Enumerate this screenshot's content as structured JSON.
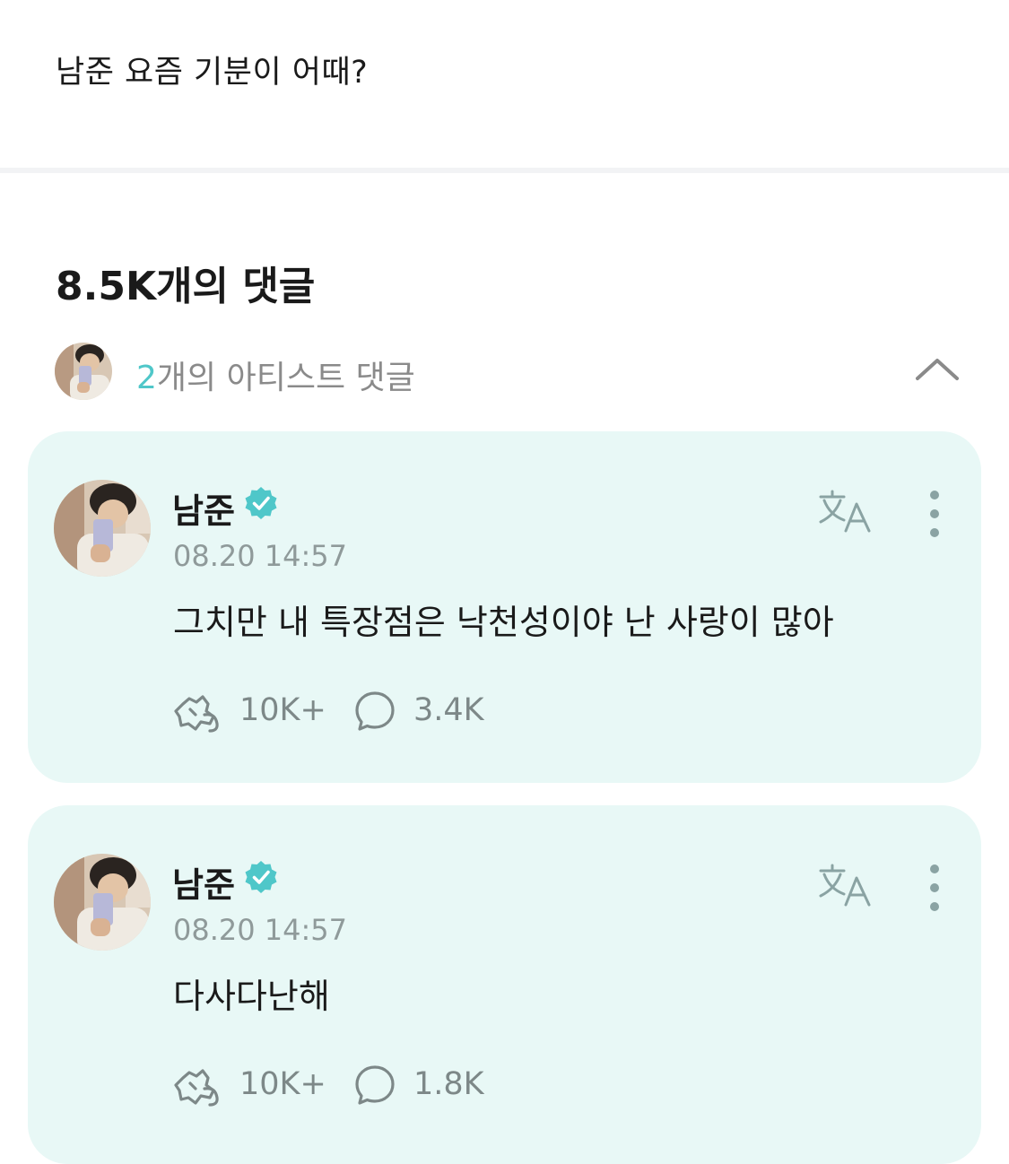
{
  "post": {
    "text": "남준 요즘 기분이 어때?"
  },
  "comments_header": {
    "count_label": "8.5K개의 댓글"
  },
  "artist_section": {
    "count_number": "2",
    "count_suffix": "개의 아티스트 댓글",
    "collapse_icon": "chevron-up-icon"
  },
  "comments": [
    {
      "author": "남준",
      "verified": true,
      "timestamp": "08.20 14:57",
      "text": "그치만 내 특장점은 낙천성이야 난 사랑이 많아",
      "likes": "10K+",
      "replies": "3.4K"
    },
    {
      "author": "남준",
      "verified": true,
      "timestamp": "08.20 14:57",
      "text": "다사다난해",
      "likes": "10K+",
      "replies": "1.8K"
    }
  ],
  "colors": {
    "accent": "#4fc7c9",
    "card_background": "#e8f8f6",
    "muted_text": "#8f9a9a",
    "icon_gray": "#7d8888"
  }
}
